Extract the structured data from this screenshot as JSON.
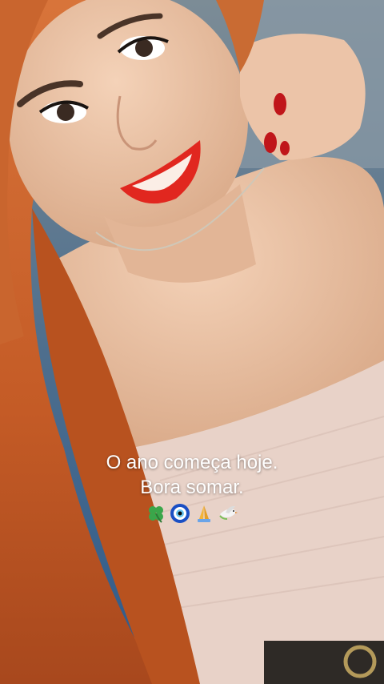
{
  "caption": {
    "line1": "O ano começa hoje.",
    "line2": "Bora somar."
  },
  "emojis": [
    "four-leaf-clover-icon",
    "nazar-eye-icon",
    "praying-hands-icon",
    "dove-icon"
  ],
  "colors": {
    "lipstick": "#e1271f",
    "hair": "#c9652e",
    "skin": "#e9bfa2",
    "background_blue": "#2d5a8c",
    "top_fabric": "#e8d2c8"
  }
}
